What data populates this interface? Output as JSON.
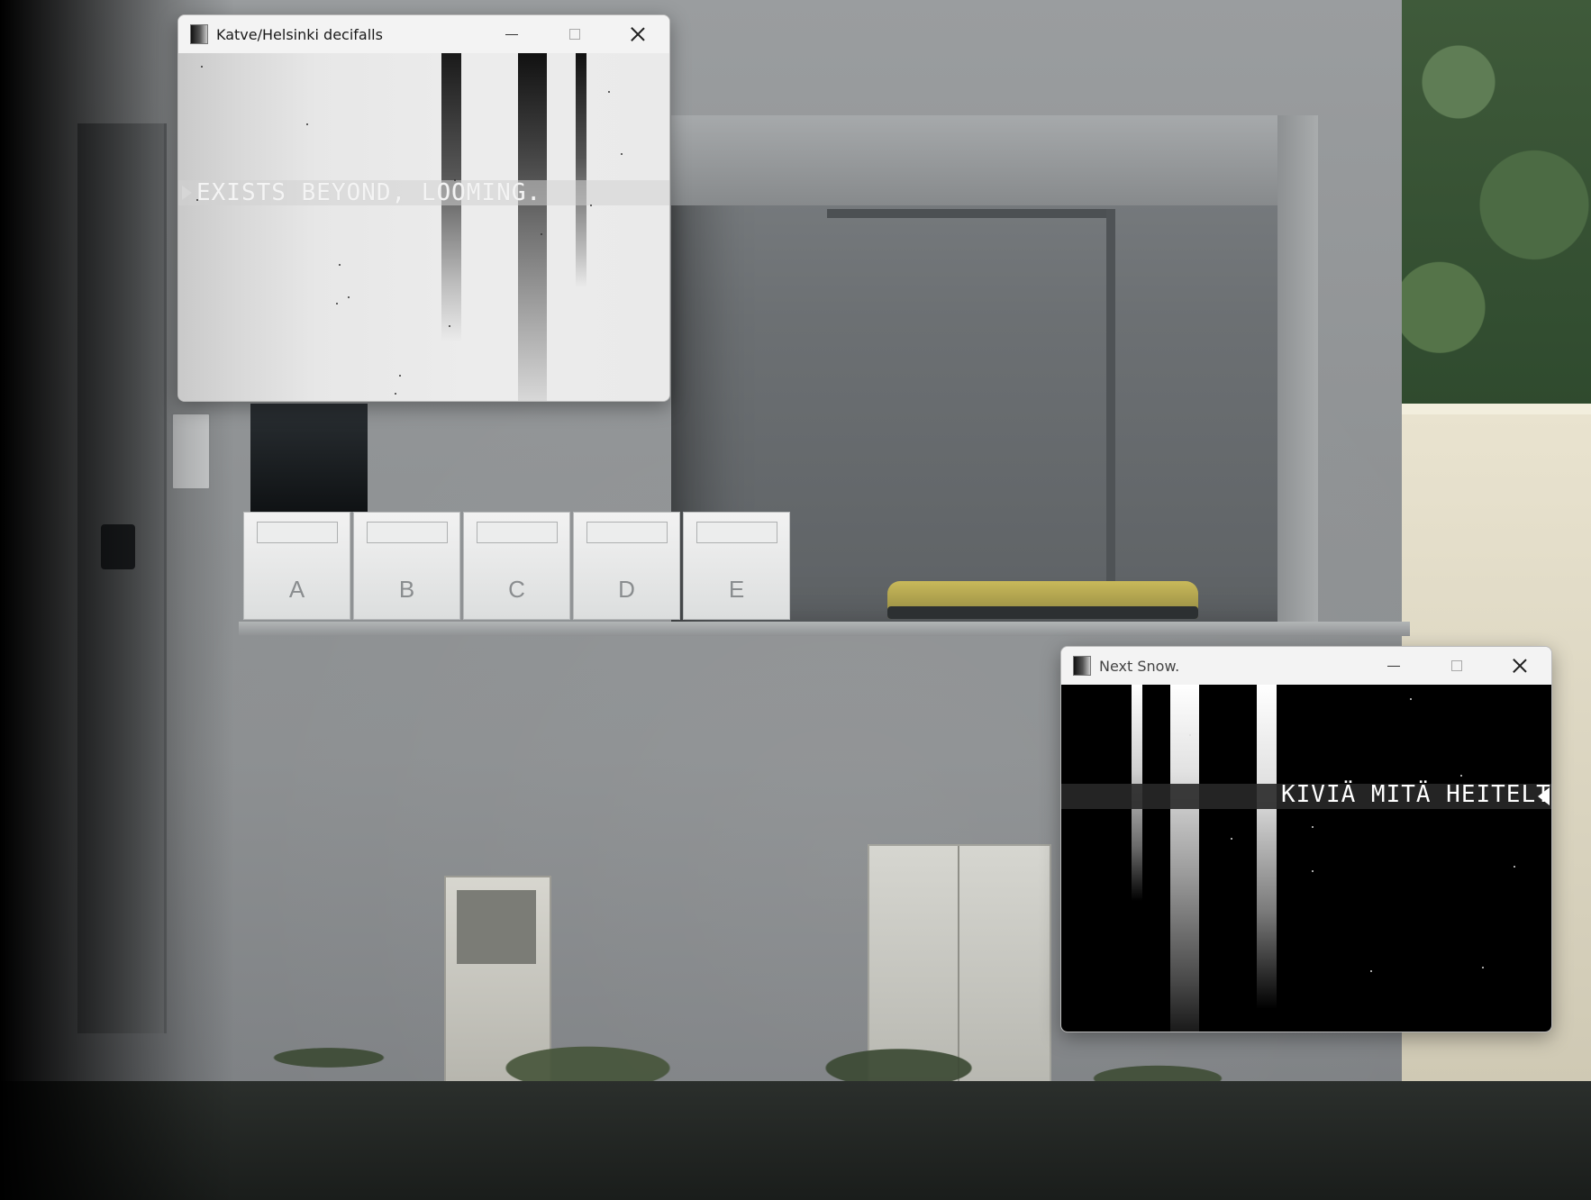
{
  "desktop": {
    "mailbox_letters": [
      "A",
      "B",
      "C",
      "D",
      "E"
    ]
  },
  "windows": [
    {
      "id": "win1",
      "title": "Katve/Helsinki decifalls",
      "canvas_text": "EXISTS BEYOND, LOOMING.",
      "theme": "light",
      "bar_color": "#1a1a1a",
      "star_color": "#333333"
    },
    {
      "id": "win2",
      "title": "Next Snow.",
      "canvas_text": "KIVIÄ MITÄ HEITELTIIN",
      "theme": "dark",
      "bar_color": "#ffffff",
      "star_color": "#dddddd"
    }
  ]
}
